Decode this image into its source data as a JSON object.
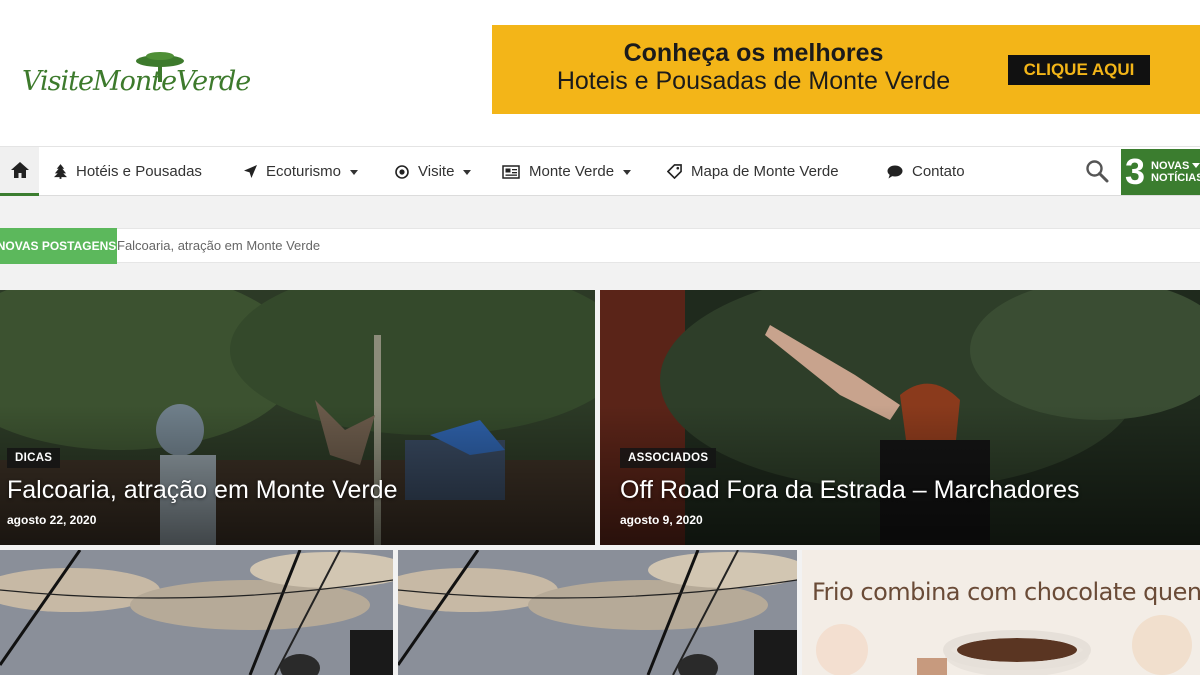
{
  "header": {
    "logo": {
      "text": "VisiteMonteVerde",
      "icon": "pine-tree-icon"
    },
    "banner": {
      "line1": "Conheça os melhores",
      "line2": "Hoteis e Pousadas de Monte Verde",
      "button": "CLIQUE AQUI",
      "bg_color": "#f3b518"
    }
  },
  "nav": {
    "items": [
      {
        "label": "Hotéis e Pousadas",
        "icon": "tree-icon",
        "dropdown": false
      },
      {
        "label": "Ecoturismo",
        "icon": "location-arrow-icon",
        "dropdown": true
      },
      {
        "label": "Visite",
        "icon": "target-icon",
        "dropdown": true
      },
      {
        "label": "Monte Verde",
        "icon": "newspaper-icon",
        "dropdown": true
      },
      {
        "label": "Mapa de Monte Verde",
        "icon": "tag-icon",
        "dropdown": false
      },
      {
        "label": "Contato",
        "icon": "comment-icon",
        "dropdown": false
      }
    ],
    "news": {
      "count": "3",
      "line1": "NOVAS",
      "line2": "NOTÍCIAS"
    },
    "accent_color": "#3b7d2f"
  },
  "ticker": {
    "label": "NOVAS POSTAGENS",
    "text": "Falcoaria, atração em Monte Verde"
  },
  "featured": [
    {
      "category": "DICAS",
      "title": "Falcoaria, atração em Monte Verde",
      "date": "agosto 22, 2020"
    },
    {
      "category": "ASSOCIADOS",
      "title": "Off Road Fora da Estrada – Marchadores",
      "date": "agosto 9, 2020"
    }
  ],
  "grid": {
    "chocolate_text": "Frio combina com chocolate quente!"
  }
}
